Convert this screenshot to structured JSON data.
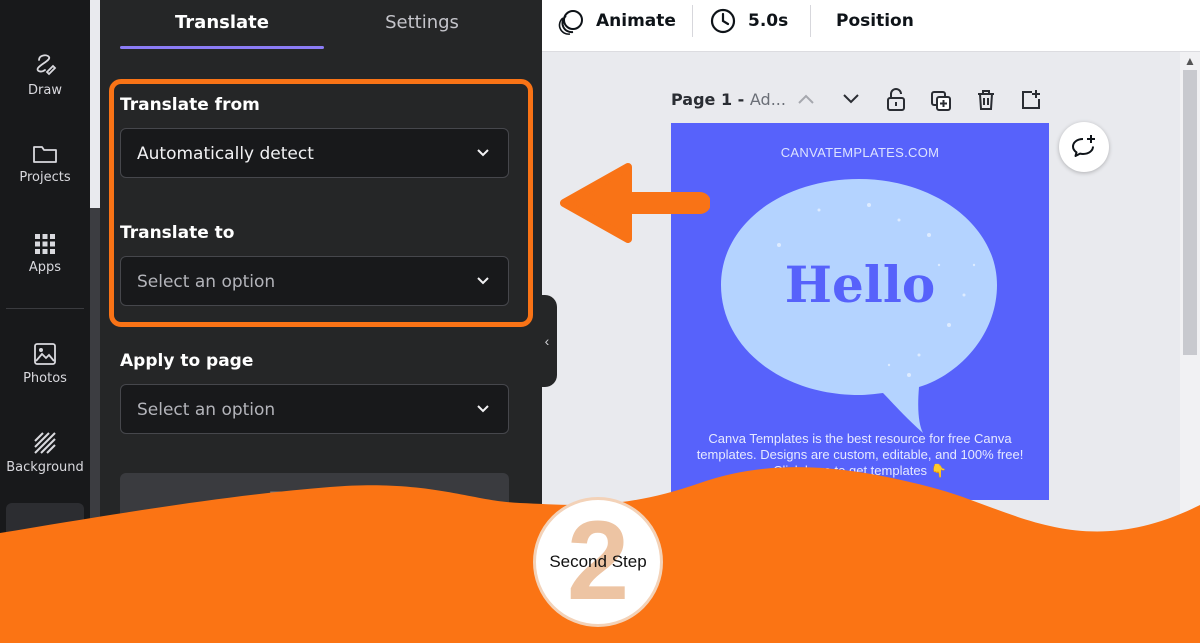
{
  "sidebar": {
    "items": [
      {
        "label": "Draw",
        "icon": "draw-icon"
      },
      {
        "label": "Projects",
        "icon": "folder-icon"
      },
      {
        "label": "Apps",
        "icon": "apps-grid-icon"
      },
      {
        "label": "Photos",
        "icon": "photo-icon"
      },
      {
        "label": "Background",
        "icon": "background-pattern-icon"
      }
    ]
  },
  "panel": {
    "tabs": [
      {
        "label": "Translate",
        "active": true
      },
      {
        "label": "Settings",
        "active": false
      }
    ],
    "translate_from": {
      "label": "Translate from",
      "value": "Automatically detect"
    },
    "translate_to": {
      "label": "Translate to",
      "placeholder": "Select an option"
    },
    "apply_to_page": {
      "label": "Apply to page",
      "placeholder": "Select an option"
    },
    "apply_button_label": "Translate"
  },
  "topbar": {
    "animate_label": "Animate",
    "duration_label": "5.0s",
    "position_label": "Position"
  },
  "page": {
    "title": "Page 1 -",
    "subtitle": "Ad..."
  },
  "design": {
    "site": "CANVATEMPLATES.COM",
    "headline": "Hello",
    "body": "Canva Templates is the best resource for free Canva templates. Designs are custom, editable, and 100% free! Click here to get templates 👇"
  },
  "step": {
    "number": "2",
    "label": "Second Step"
  },
  "colors": {
    "accent_orange": "#f97316",
    "panel_bg": "#252627",
    "tab_underline": "#8b7cf6",
    "design_bg": "#5762fb",
    "bubble": "#b4d3ff"
  }
}
